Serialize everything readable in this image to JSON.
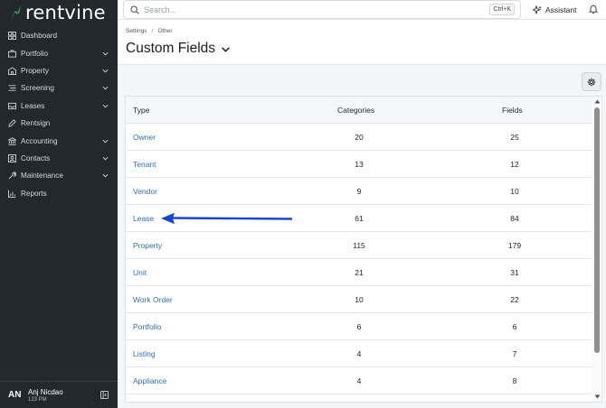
{
  "app": {
    "name": "rentvine"
  },
  "sidebar": {
    "items": [
      {
        "label": "Dashboard",
        "icon": "dashboard-icon",
        "has_children": false
      },
      {
        "label": "Portfolio",
        "icon": "briefcase-icon",
        "has_children": true
      },
      {
        "label": "Property",
        "icon": "building-icon",
        "has_children": true
      },
      {
        "label": "Screening",
        "icon": "list-icon",
        "has_children": true
      },
      {
        "label": "Leases",
        "icon": "inbox-icon",
        "has_children": true
      },
      {
        "label": "Rentsign",
        "icon": "pen-icon",
        "has_children": false
      },
      {
        "label": "Accounting",
        "icon": "bank-icon",
        "has_children": true
      },
      {
        "label": "Contacts",
        "icon": "contacts-icon",
        "has_children": true
      },
      {
        "label": "Maintenance",
        "icon": "wrench-icon",
        "has_children": true
      },
      {
        "label": "Reports",
        "icon": "chart-icon",
        "has_children": false
      }
    ],
    "user": {
      "initials": "AN",
      "name": "Anj Nicdao",
      "subtext": "123 PM"
    }
  },
  "topbar": {
    "search_placeholder": "Search...",
    "search_shortcut": "Ctrl+K",
    "assistant_label": "Assistant"
  },
  "breadcrumb": {
    "parent": "Settings",
    "separator": "/",
    "current": "Other"
  },
  "page": {
    "title": "Custom Fields"
  },
  "table": {
    "columns": {
      "type": "Type",
      "categories": "Categories",
      "fields": "Fields"
    },
    "rows": [
      {
        "type": "Owner",
        "categories": "20",
        "fields": "25"
      },
      {
        "type": "Tenant",
        "categories": "13",
        "fields": "12"
      },
      {
        "type": "Vendor",
        "categories": "9",
        "fields": "10"
      },
      {
        "type": "Lease",
        "categories": "61",
        "fields": "84"
      },
      {
        "type": "Property",
        "categories": "115",
        "fields": "179"
      },
      {
        "type": "Unit",
        "categories": "21",
        "fields": "31"
      },
      {
        "type": "Work Order",
        "categories": "10",
        "fields": "22"
      },
      {
        "type": "Portfolio",
        "categories": "6",
        "fields": "6"
      },
      {
        "type": "Listing",
        "categories": "4",
        "fields": "7"
      },
      {
        "type": "Appliance",
        "categories": "4",
        "fields": "8"
      }
    ]
  },
  "colors": {
    "sidebar_bg": "#23282d",
    "brand_green": "#2bb673",
    "link_blue": "#2f6fba",
    "annotation_arrow": "#1746d6"
  }
}
